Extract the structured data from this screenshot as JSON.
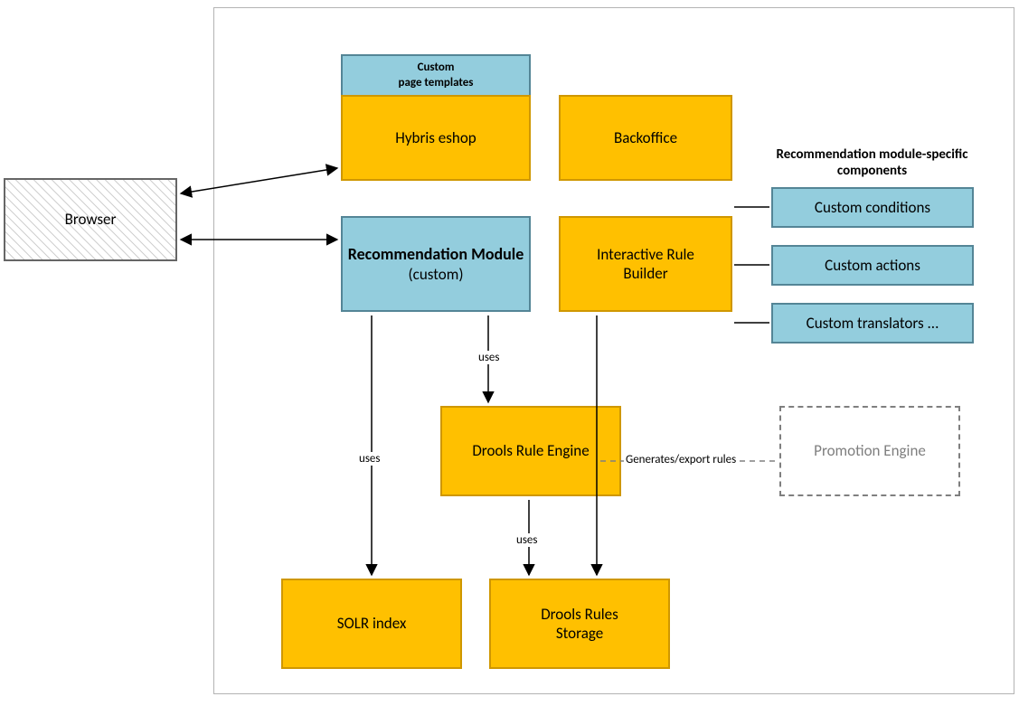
{
  "nodes": {
    "browser": "Browser",
    "custom_templates_l1": "Custom",
    "custom_templates_l2": "page templates",
    "hybris_eshop": "Hybris eshop",
    "backoffice": "Backoffice",
    "reco_title": "Recommendation Module",
    "reco_sub": "(custom)",
    "rule_builder_l1": "Interactive Rule",
    "rule_builder_l2": "Builder",
    "custom_conditions": "Custom conditions",
    "custom_actions": "Custom actions",
    "custom_translators": "Custom translators ...",
    "drools_engine": "Drools Rule Engine",
    "promotion_engine": "Promotion Engine",
    "solr": "SOLR index",
    "drools_storage_l1": "Drools Rules",
    "drools_storage_l2": "Storage"
  },
  "labels": {
    "reco_components": "Recommendation module-specific components",
    "uses": "uses",
    "generates": "Generates/export rules"
  }
}
